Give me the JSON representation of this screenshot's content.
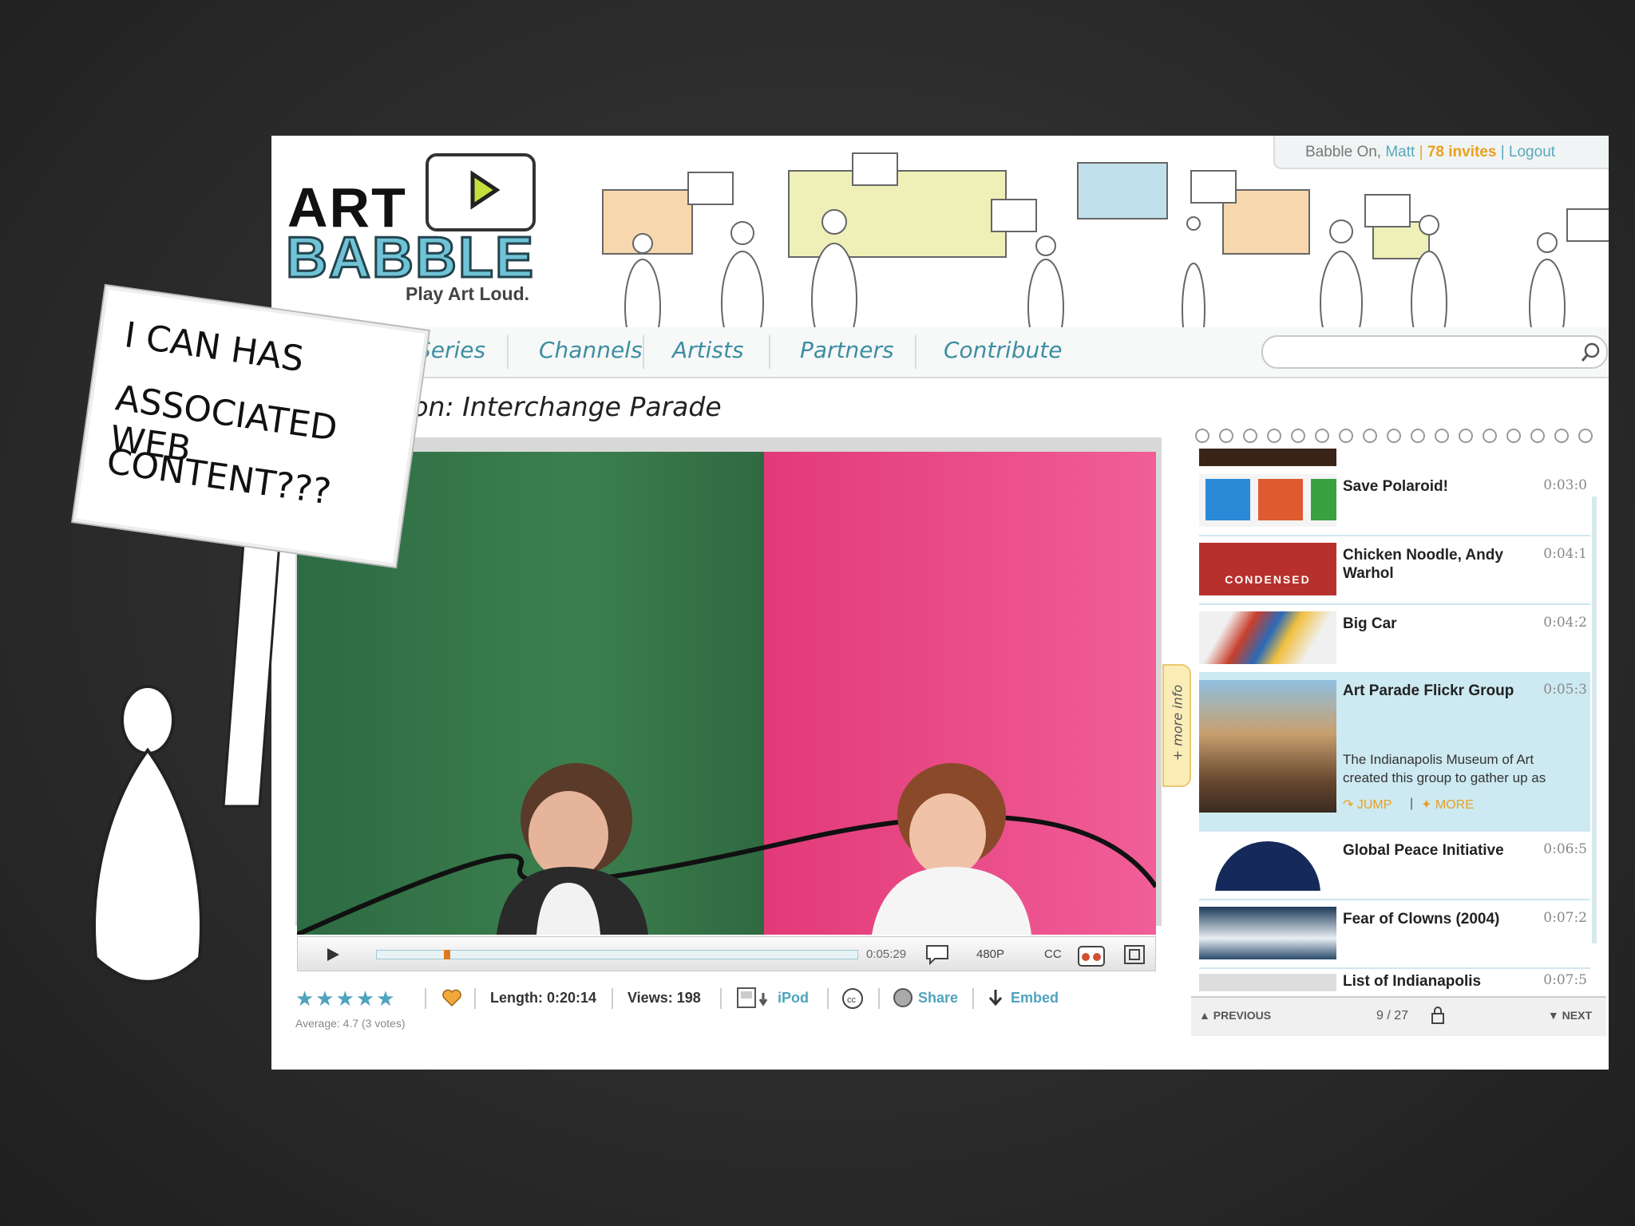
{
  "user_bar": {
    "prefix": "Babble On,",
    "username": "Matt",
    "sep": "|",
    "invites": "78 invites",
    "logout": "Logout"
  },
  "logo": {
    "art": "ART",
    "babble": "BABBLE",
    "tagline": "Play Art Loud."
  },
  "nav": {
    "items": [
      {
        "label": "Series"
      },
      {
        "label": "Channels"
      },
      {
        "label": "Artists"
      },
      {
        "label": "Partners"
      },
      {
        "label": "Contribute"
      }
    ]
  },
  "search": {
    "placeholder": ""
  },
  "page_title": "sion: Interchange Parade",
  "player": {
    "time": "0:05:29",
    "quality": "480P",
    "cc": "CC",
    "more_info": "+ more info"
  },
  "meta": {
    "length": "Length: 0:20:14",
    "views": "Views: 198",
    "ipod": "iPod",
    "share": "Share",
    "embed": "Embed",
    "average": "Average: 4.7 (3 votes)",
    "rating": 4.7
  },
  "playlist": {
    "items": [
      {
        "title": "Save Polaroid!",
        "time": "0:03:0"
      },
      {
        "title": "Chicken Noodle, Andy Warhol",
        "time": "0:04:1"
      },
      {
        "title": "Big Car",
        "time": "0:04:2"
      },
      {
        "title": "Art Parade Flickr Group",
        "time": "0:05:3",
        "desc": "The Indianapolis Museum of Art created this group to gather up as",
        "jump": "JUMP",
        "more": "MORE"
      },
      {
        "title": "Global Peace Initiative",
        "time": "0:06:5"
      },
      {
        "title": "Fear of Clowns (2004)",
        "time": "0:07:2"
      },
      {
        "title": "List of Indianapolis",
        "time": "0:07:5"
      }
    ],
    "previous": "PREVIOUS",
    "page": "9 / 27",
    "next": "NEXT",
    "condensed": "CONDENSED"
  },
  "sign": {
    "lines": [
      "I CAN HAS",
      "ASSOCIATED WEB",
      "CONTENT???"
    ]
  },
  "colors": {
    "accent": "#3d8ea2",
    "invites": "#e8a020",
    "highlight": "#cde9f1",
    "video_green": "#27693e",
    "video_pink": "#e8417f"
  }
}
